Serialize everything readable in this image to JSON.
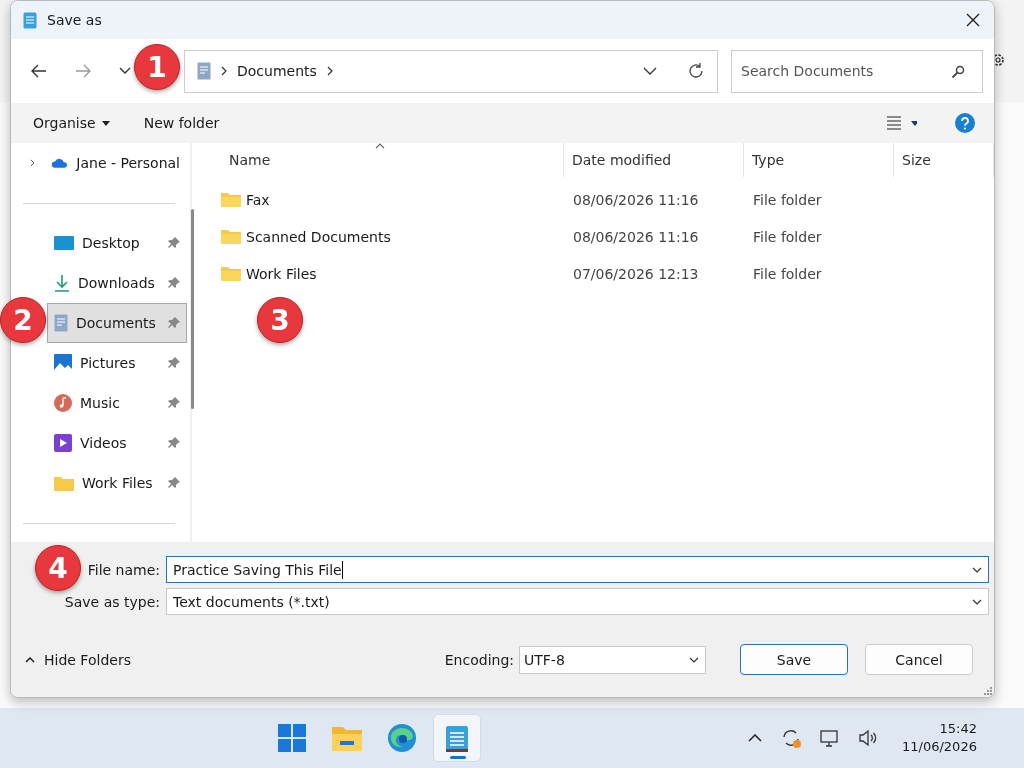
{
  "window": {
    "title": "Save as"
  },
  "navigation": {
    "breadcrumb": [
      "Documents"
    ],
    "search": {
      "placeholder": "Search Documents"
    }
  },
  "toolbar": {
    "organise": "Organise",
    "new_folder": "New folder"
  },
  "sidebar": {
    "items": [
      {
        "label": "Jane - Personal",
        "expanded": false,
        "pinned": false,
        "selected": false
      },
      {
        "label": "Desktop",
        "pinned": true,
        "selected": false
      },
      {
        "label": "Downloads",
        "pinned": true,
        "selected": false
      },
      {
        "label": "Documents",
        "pinned": true,
        "selected": true
      },
      {
        "label": "Pictures",
        "pinned": true,
        "selected": false
      },
      {
        "label": "Music",
        "pinned": true,
        "selected": false
      },
      {
        "label": "Videos",
        "pinned": true,
        "selected": false
      },
      {
        "label": "Work Files",
        "pinned": true,
        "selected": false
      }
    ]
  },
  "table": {
    "columns": [
      {
        "label": "Name",
        "sorted": true
      },
      {
        "label": "Date modified",
        "sorted": false
      },
      {
        "label": "Type",
        "sorted": false
      },
      {
        "label": "Size",
        "sorted": false
      }
    ],
    "rows": [
      {
        "name": "Fax",
        "date_modified": "08/06/2026 11:16",
        "type": "File folder"
      },
      {
        "name": "Scanned Documents",
        "date_modified": "08/06/2026 11:16",
        "type": "File folder"
      },
      {
        "name": "Work Files",
        "date_modified": "07/06/2026 12:13",
        "type": "File folder"
      }
    ]
  },
  "form": {
    "file_name": {
      "label": "File name:",
      "value": "Practice Saving This File"
    },
    "save_type": {
      "label": "Save as type:",
      "value": "Text documents (*.txt)"
    }
  },
  "footer": {
    "hide_folders": "Hide Folders",
    "encoding": {
      "label": "Encoding:",
      "value": "UTF-8"
    },
    "buttons": [
      {
        "label": "Save",
        "default": true
      },
      {
        "label": "Cancel",
        "default": false
      }
    ]
  },
  "markers": [
    "1",
    "2",
    "3",
    "4"
  ],
  "taskbar": {
    "apps": [
      {
        "selected": false
      },
      {
        "selected": false
      },
      {
        "selected": false
      },
      {
        "selected": true
      }
    ],
    "time": "15:42",
    "date": "11/06/2026"
  }
}
